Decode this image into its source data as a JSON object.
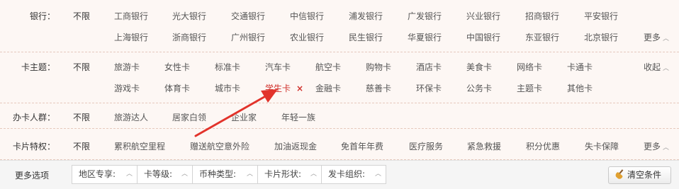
{
  "rows": {
    "bank": {
      "label": "银行：",
      "unlimited": "不限",
      "line1": [
        "工商银行",
        "光大银行",
        "交通银行",
        "中信银行",
        "浦发银行",
        "广发银行",
        "兴业银行",
        "招商银行",
        "平安银行"
      ],
      "line2": [
        "上海银行",
        "浙商银行",
        "广州银行",
        "农业银行",
        "民生银行",
        "华夏银行",
        "中国银行",
        "东亚银行",
        "北京银行"
      ],
      "toggle": "更多"
    },
    "theme": {
      "label": "卡主题：",
      "unlimited": "不限",
      "line1": [
        "旅游卡",
        "女性卡",
        "标准卡",
        "汽车卡",
        "航空卡",
        "购物卡",
        "酒店卡",
        "美食卡",
        "网络卡",
        "卡通卡"
      ],
      "line2": [
        "游戏卡",
        "体育卡",
        "城市卡",
        "学生卡",
        "金融卡",
        "慈善卡",
        "环保卡",
        "公务卡",
        "主题卡",
        "其他卡"
      ],
      "selected": "学生卡",
      "remove_mark": "×",
      "toggle": "收起"
    },
    "crowd": {
      "label": "办卡人群：",
      "unlimited": "不限",
      "line1": [
        "旅游达人",
        "居家白领",
        "企业家",
        "年轻一族"
      ]
    },
    "privilege": {
      "label": "卡片特权：",
      "unlimited": "不限",
      "line1": [
        "累积航空里程",
        "赠送航空意外险",
        "加油返现金",
        "免首年年费",
        "医疗服务",
        "紧急救援",
        "积分优惠",
        "失卡保障"
      ],
      "toggle": "更多"
    }
  },
  "more_options": {
    "label": "更多选项",
    "selects": [
      "地区专享:",
      "卡等级:",
      "币种类型:",
      "卡片形状:",
      "发卡组织:"
    ],
    "clear_button": "清空条件"
  },
  "icons": {
    "collapse_caret": "chevron-up-icon",
    "select_caret": "chevron-up-icon",
    "clear_icon": "broom-icon"
  },
  "colors": {
    "selected": "#d0302b",
    "row_bg": "#fdf7f4",
    "arrow": "#e2332b"
  }
}
